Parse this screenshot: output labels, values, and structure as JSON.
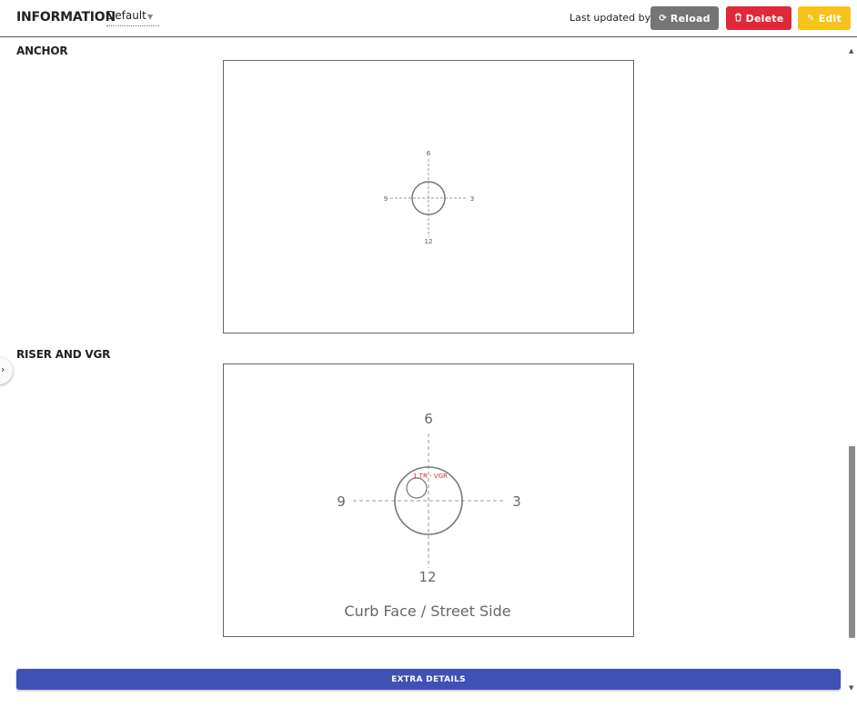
{
  "header": {
    "title": "INFORMATION",
    "view_select": {
      "value": "Default"
    },
    "last_updated_label": "Last updated by:",
    "buttons": {
      "reload": "Reload",
      "delete": "Delete",
      "edit": "Edit"
    }
  },
  "sections": {
    "anchor": {
      "label": "ANCHOR",
      "diagram": {
        "top": "6",
        "bottom": "12",
        "left": "9",
        "right": "3"
      }
    },
    "riser": {
      "label": "RISER AND VGR",
      "diagram": {
        "top": "6",
        "bottom": "12",
        "left": "9",
        "right": "3",
        "marker_label": "1.TR - VGR",
        "caption": "Curb Face / Street Side"
      }
    }
  },
  "footer": {
    "extra_details": "EXTRA DETAILS"
  },
  "colors": {
    "reload": "#757575",
    "delete": "#e0283b",
    "edit": "#f7c31b",
    "extra_bar": "#3f51b5",
    "marker": "#c0392b"
  }
}
